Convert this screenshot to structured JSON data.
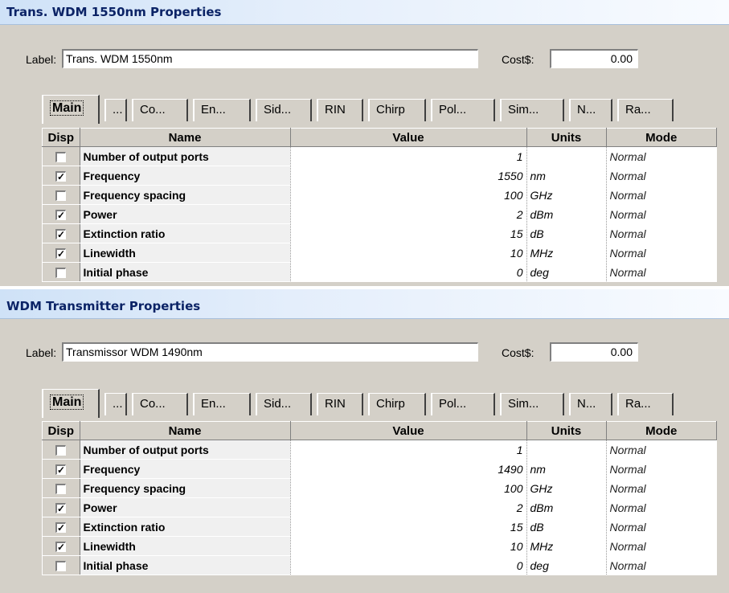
{
  "dialogs": [
    {
      "title": "Trans. WDM 1550nm Properties",
      "label_caption": "Label:",
      "label_value": "Trans. WDM 1550nm",
      "cost_caption": "Cost$:",
      "cost_value": "0.00",
      "tabs": [
        "Main",
        "...",
        "Co...",
        "En...",
        "Sid...",
        "RIN",
        "Chirp",
        "Pol...",
        "Sim...",
        "N...",
        "Ra..."
      ],
      "columns": [
        "Disp",
        "Name",
        "Value",
        "Units",
        "Mode"
      ],
      "rows": [
        {
          "disp": false,
          "name": "Number of output ports",
          "value": "1",
          "units": "",
          "mode": "Normal"
        },
        {
          "disp": true,
          "name": "Frequency",
          "value": "1550",
          "units": "nm",
          "mode": "Normal"
        },
        {
          "disp": false,
          "name": "Frequency spacing",
          "value": "100",
          "units": "GHz",
          "mode": "Normal"
        },
        {
          "disp": true,
          "name": "Power",
          "value": "2",
          "units": "dBm",
          "mode": "Normal"
        },
        {
          "disp": true,
          "name": "Extinction ratio",
          "value": "15",
          "units": "dB",
          "mode": "Normal"
        },
        {
          "disp": true,
          "name": "Linewidth",
          "value": "10",
          "units": "MHz",
          "mode": "Normal"
        },
        {
          "disp": false,
          "name": "Initial phase",
          "value": "0",
          "units": "deg",
          "mode": "Normal"
        }
      ]
    },
    {
      "title": "WDM Transmitter Properties",
      "label_caption": "Label:",
      "label_value": "Transmissor WDM 1490nm",
      "cost_caption": "Cost$:",
      "cost_value": "0.00",
      "tabs": [
        "Main",
        "...",
        "Co...",
        "En...",
        "Sid...",
        "RIN",
        "Chirp",
        "Pol...",
        "Sim...",
        "N...",
        "Ra..."
      ],
      "columns": [
        "Disp",
        "Name",
        "Value",
        "Units",
        "Mode"
      ],
      "rows": [
        {
          "disp": false,
          "name": "Number of output ports",
          "value": "1",
          "units": "",
          "mode": "Normal"
        },
        {
          "disp": true,
          "name": "Frequency",
          "value": "1490",
          "units": "nm",
          "mode": "Normal"
        },
        {
          "disp": false,
          "name": "Frequency spacing",
          "value": "100",
          "units": "GHz",
          "mode": "Normal"
        },
        {
          "disp": true,
          "name": "Power",
          "value": "2",
          "units": "dBm",
          "mode": "Normal"
        },
        {
          "disp": true,
          "name": "Extinction ratio",
          "value": "15",
          "units": "dB",
          "mode": "Normal"
        },
        {
          "disp": true,
          "name": "Linewidth",
          "value": "10",
          "units": "MHz",
          "mode": "Normal"
        },
        {
          "disp": false,
          "name": "Initial phase",
          "value": "0",
          "units": "deg",
          "mode": "Normal"
        }
      ]
    }
  ]
}
